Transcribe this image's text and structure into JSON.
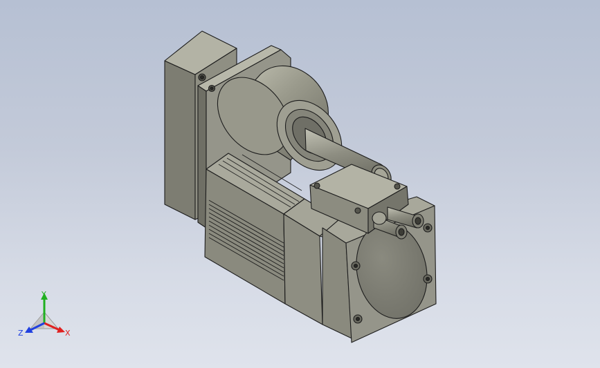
{
  "viewport": {
    "background_top": "#b6c0d3",
    "background_bottom": "#dfe3ec",
    "part_color": "#8d8d80",
    "edge_color": "#1c1c1c"
  },
  "triad": {
    "x_label": "X",
    "y_label": "Y",
    "z_label": "Z",
    "x_color": "#e02020",
    "y_color": "#20b020",
    "z_color": "#2040e0"
  }
}
